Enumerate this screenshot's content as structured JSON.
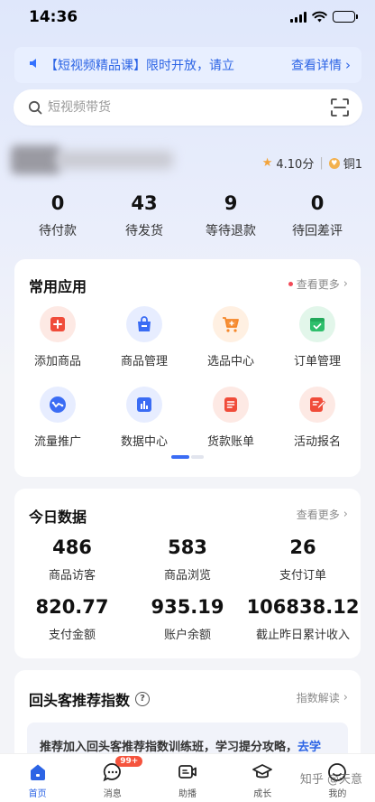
{
  "status_bar": {
    "time": "14:36"
  },
  "notice": {
    "text": "【短视频精品课】限时开放，请立",
    "link": "查看详情"
  },
  "search": {
    "placeholder": "短视频带货"
  },
  "profile": {
    "rating": "4.10分",
    "level": "铜1"
  },
  "order_stats": [
    {
      "value": "0",
      "label": "待付款"
    },
    {
      "value": "43",
      "label": "待发货"
    },
    {
      "value": "9",
      "label": "等待退款"
    },
    {
      "value": "0",
      "label": "待回差评"
    }
  ],
  "apps_section": {
    "title": "常用应用",
    "more": "查看更多",
    "items": [
      {
        "label": "添加商品",
        "icon": "add-product-icon"
      },
      {
        "label": "商品管理",
        "icon": "product-bag-icon"
      },
      {
        "label": "选品中心",
        "icon": "cart-icon"
      },
      {
        "label": "订单管理",
        "icon": "order-check-icon"
      },
      {
        "label": "流量推广",
        "icon": "traffic-promo-icon"
      },
      {
        "label": "数据中心",
        "icon": "data-chart-icon"
      },
      {
        "label": "货款账单",
        "icon": "bill-icon"
      },
      {
        "label": "活动报名",
        "icon": "activity-signup-icon"
      }
    ]
  },
  "today_section": {
    "title": "今日数据",
    "more": "查看更多",
    "rows": [
      [
        {
          "value": "486",
          "label": "商品访客"
        },
        {
          "value": "583",
          "label": "商品浏览"
        },
        {
          "value": "26",
          "label": "支付订单"
        }
      ],
      [
        {
          "value": "820.77",
          "label": "支付金额"
        },
        {
          "value": "935.19",
          "label": "账户余额"
        },
        {
          "value": "106838.12",
          "label": "截止昨日累计收入"
        }
      ]
    ]
  },
  "repeat_section": {
    "title": "回头客推荐指数",
    "more": "指数解读",
    "text": "推荐加入回头客推荐指数训练班，学习提分攻略，",
    "link": "去学"
  },
  "tabbar": {
    "badge": "99+",
    "items": [
      {
        "label": "首页",
        "icon": "home-icon"
      },
      {
        "label": "消息",
        "icon": "message-icon"
      },
      {
        "label": "助播",
        "icon": "live-assist-icon"
      },
      {
        "label": "成长",
        "icon": "graduation-cap-icon"
      },
      {
        "label": "我的",
        "icon": "profile-icon"
      }
    ]
  },
  "watermark": "知乎 @天意",
  "colors": {
    "accent": "#2c64e5",
    "badge": "#f5533d",
    "star": "#f2a33a"
  }
}
